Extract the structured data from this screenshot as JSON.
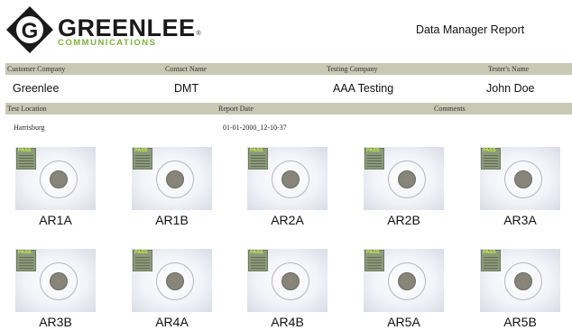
{
  "brand": {
    "name": "GREENLEE",
    "registered": "®",
    "sub": "COMMUNICATIONS",
    "colors": {
      "green": "#7bb241",
      "dark": "#1a1a1a"
    }
  },
  "report_title": "Data Manager Report",
  "info_bar_1": {
    "labels": [
      "Customer Company",
      "Contact Name",
      "Testing Company",
      "Tester's Name"
    ],
    "values": [
      "Greenlee",
      "DMT",
      "AAA Testing",
      "John Doe"
    ]
  },
  "info_bar_2": {
    "labels": [
      "Test Location",
      "Report Date",
      "Comments"
    ],
    "values": [
      "Harrisburg",
      "01-01-2000_12-10-37",
      ""
    ]
  },
  "results": [
    {
      "label": "AR1A",
      "status": "PASS"
    },
    {
      "label": "AR1B",
      "status": "PASS"
    },
    {
      "label": "AR2A",
      "status": "PASS"
    },
    {
      "label": "AR2B",
      "status": "PASS"
    },
    {
      "label": "AR3A",
      "status": "PASS"
    },
    {
      "label": "AR3B",
      "status": "PASS"
    },
    {
      "label": "AR4A",
      "status": "PASS"
    },
    {
      "label": "AR4B",
      "status": "PASS"
    },
    {
      "label": "AR5A",
      "status": "PASS"
    },
    {
      "label": "AR5B",
      "status": "PASS"
    }
  ]
}
